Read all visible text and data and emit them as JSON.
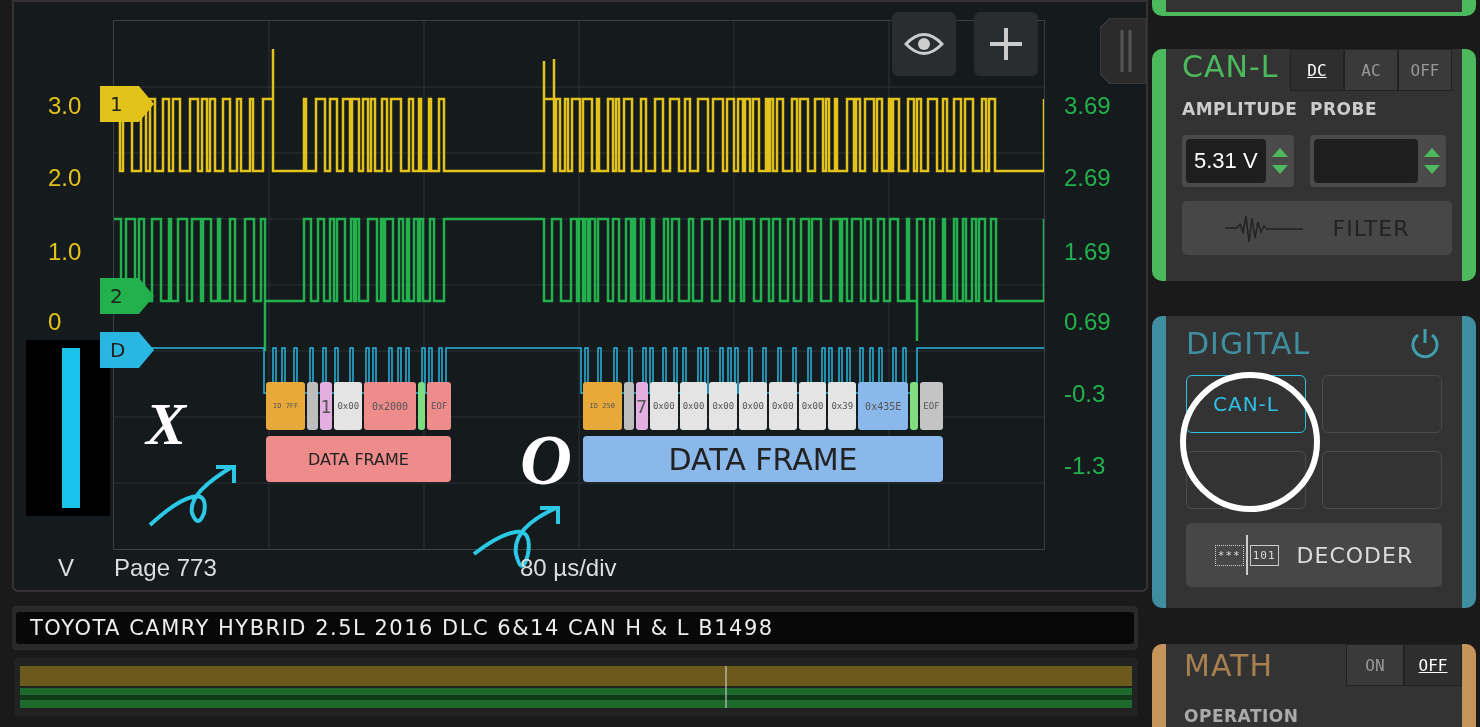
{
  "scope": {
    "left_axis": [
      "3.0",
      "2.0",
      "1.0",
      "0"
    ],
    "right_axis": [
      "3.69",
      "2.69",
      "1.69",
      "0.69",
      "-0.3",
      "-1.3"
    ],
    "channels": [
      {
        "label": "1",
        "color": "#e3c21a"
      },
      {
        "label": "2",
        "color": "#22b14c"
      },
      {
        "label": "D",
        "color": "#29b6e0"
      }
    ],
    "decoded_frames": [
      {
        "label": "DATA FRAME",
        "color": "#ee8b8b",
        "fields": [
          {
            "kind": "id",
            "text": "ID 7FF",
            "color": "#e8a93a"
          },
          {
            "kind": "gap",
            "color": "#bdbdbd"
          },
          {
            "kind": "dlc",
            "text": "1",
            "color": "#e3aee0"
          },
          {
            "kind": "data",
            "text": "0x00",
            "color": "#e4e4e4"
          },
          {
            "kind": "crc",
            "text": "0x2000",
            "color": "#ee8b8b"
          },
          {
            "kind": "ack",
            "color": "#7fdc7f"
          },
          {
            "kind": "eof",
            "text": "EOF",
            "color": "#ee8b8b"
          }
        ]
      },
      {
        "label": "DATA FRAME",
        "color": "#8bb8ea",
        "fields": [
          {
            "kind": "id",
            "text": "ID 250",
            "color": "#e8a93a"
          },
          {
            "kind": "gap",
            "color": "#bdbdbd"
          },
          {
            "kind": "dlc",
            "text": "7",
            "color": "#e3aee0"
          },
          {
            "kind": "data",
            "text": "0x00",
            "color": "#e4e4e4"
          },
          {
            "kind": "data",
            "text": "0x00",
            "color": "#e4e4e4"
          },
          {
            "kind": "data",
            "text": "0x00",
            "color": "#e4e4e4"
          },
          {
            "kind": "data",
            "text": "0x00",
            "color": "#e4e4e4"
          },
          {
            "kind": "data",
            "text": "0x00",
            "color": "#e4e4e4"
          },
          {
            "kind": "data",
            "text": "0x00",
            "color": "#e4e4e4"
          },
          {
            "kind": "data",
            "text": "0x39",
            "color": "#e4e4e4"
          },
          {
            "kind": "crc",
            "text": "0x435E",
            "color": "#8bb8ea"
          },
          {
            "kind": "ack",
            "color": "#7fdc7f"
          },
          {
            "kind": "eof",
            "text": "EOF",
            "color": "#c4c4c4"
          }
        ]
      }
    ],
    "annotations": [
      "X",
      "O"
    ],
    "units": "V",
    "page": "Page 773",
    "timebase": "80 µs/div"
  },
  "recording_title": "TOYOTA CAMRY HYBRID 2.5L 2016 DLC 6&14 CAN H & L B1498",
  "channel_panel": {
    "name": "CAN-L",
    "coupling": [
      {
        "label": "DC",
        "selected": true
      },
      {
        "label": "AC",
        "selected": false
      },
      {
        "label": "OFF",
        "selected": false
      }
    ],
    "amplitude_label": "AMPLITUDE",
    "amplitude": "5.31 V",
    "probe_label": "PROBE",
    "filter": "FILTER"
  },
  "digital_panel": {
    "title": "DIGITAL",
    "slots": [
      {
        "label": "CAN-L",
        "selected": true
      },
      {
        "selected": false
      },
      {
        "selected": false
      },
      {
        "selected": false
      }
    ],
    "decoder": "DECODER",
    "decoder_icon": [
      "***",
      "101"
    ]
  },
  "math_panel": {
    "title": "MATH",
    "modes": [
      {
        "label": "ON",
        "selected": false
      },
      {
        "label": "OFF",
        "selected": true
      }
    ],
    "operation_label": "OPERATION"
  }
}
